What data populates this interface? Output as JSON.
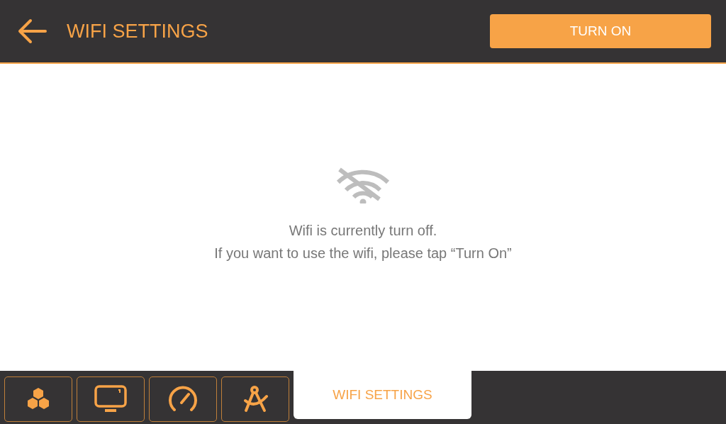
{
  "header": {
    "title": "WIFI SETTINGS",
    "action": "TURN ON"
  },
  "status": {
    "wifi_on": false,
    "lines": [
      "Wifi is currently turn off.",
      "If you want to use the wifi, please tap “Turn On”"
    ]
  },
  "tabs": [
    {
      "kind": "icon",
      "selected": false
    },
    {
      "kind": "icon",
      "selected": false
    },
    {
      "kind": "icon",
      "selected": false
    },
    {
      "kind": "icon",
      "selected": false
    },
    {
      "kind": "text",
      "label": "WIFI SETTINGS",
      "selected": true
    }
  ]
}
